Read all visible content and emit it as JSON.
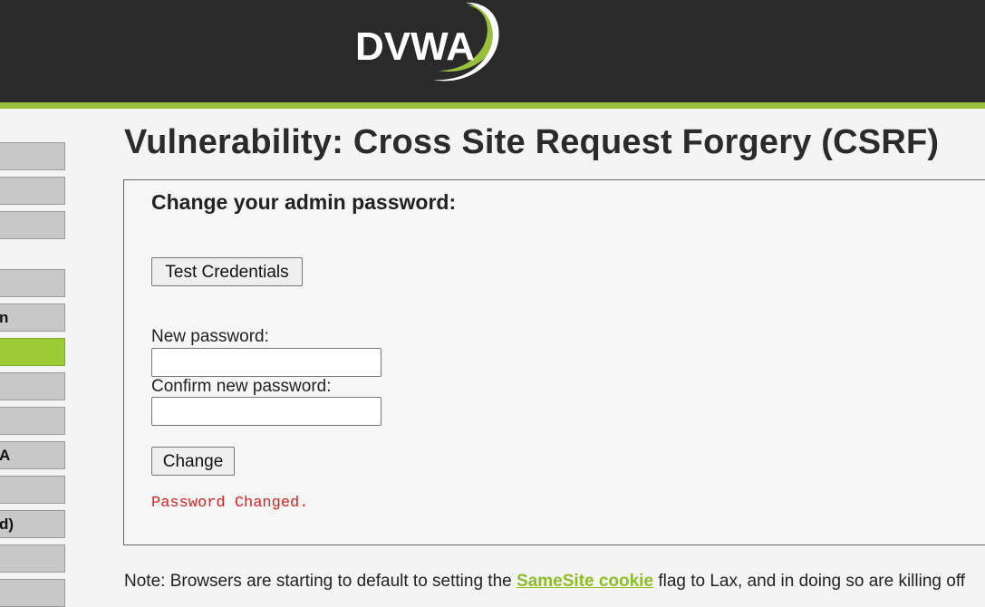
{
  "header": {
    "logo_text": "DVWA",
    "colors": {
      "background": "#2a2a2a",
      "accent": "#97c03b"
    }
  },
  "sidebar": {
    "items": [
      {
        "label": "",
        "active": false
      },
      {
        "label": "",
        "active": false
      },
      {
        "label": "",
        "active": false
      },
      {
        "label": "",
        "active": false
      },
      {
        "label": "n",
        "active": false
      },
      {
        "label": "",
        "active": true
      },
      {
        "label": "",
        "active": false
      },
      {
        "label": "",
        "active": false
      },
      {
        "label": "A",
        "active": false
      },
      {
        "label": "",
        "active": false
      },
      {
        "label": "d)",
        "active": false
      },
      {
        "label": "",
        "active": false
      },
      {
        "label": "",
        "active": false
      }
    ]
  },
  "main": {
    "title": "Vulnerability: Cross Site Request Forgery (CSRF)",
    "form": {
      "heading": "Change your admin password:",
      "test_button_label": "Test Credentials",
      "new_password_label": "New password:",
      "new_password_value": "",
      "confirm_password_label": "Confirm new password:",
      "confirm_password_value": "",
      "change_button_label": "Change",
      "result_message": "Password Changed."
    },
    "note": {
      "prefix": "Note: Browsers are starting to default to setting the ",
      "link_text": "SameSite cookie",
      "suffix": " flag to Lax, and in doing so are killing off"
    }
  }
}
